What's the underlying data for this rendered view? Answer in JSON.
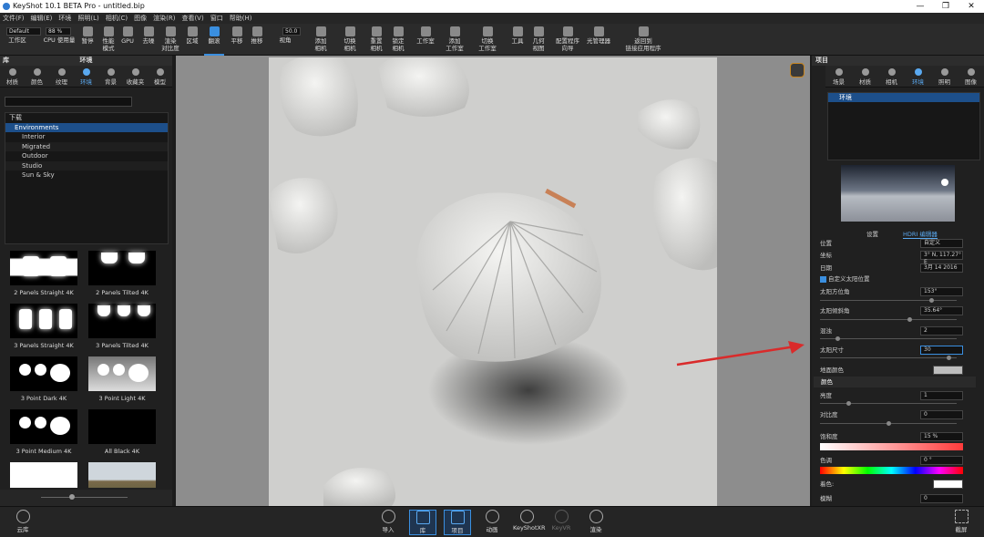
{
  "app": {
    "title": "KeyShot 10.1 BETA Pro - untitled.bip",
    "win": [
      "—",
      "❐",
      "✕"
    ]
  },
  "menu": [
    "文件(F)",
    "编辑(E)",
    "环境",
    "照明(L)",
    "相机(C)",
    "图像",
    "渲染(R)",
    "查看(V)",
    "窗口",
    "帮助(H)"
  ],
  "toolbar": {
    "workspace_value": "Default",
    "zoom_value": "88 %",
    "fov_value": "50.0",
    "items": [
      {
        "label": "工作区"
      },
      {
        "label": "CPU 使用量"
      },
      {
        "label": "暂停"
      },
      {
        "label": "性能\n模式"
      },
      {
        "label": "GPU"
      },
      {
        "label": "去噪"
      },
      {
        "label": "渲染\n对比度"
      },
      {
        "label": "区域"
      },
      {
        "label": "翻滚",
        "active": true
      },
      {
        "label": "平移"
      },
      {
        "label": "推移"
      },
      {
        "label": "视角"
      },
      {
        "label": "添加\n相机"
      },
      {
        "label": "切换\n相机"
      },
      {
        "label": "重置\n相机"
      },
      {
        "label": "锁定\n相机"
      },
      {
        "label": "工作室"
      },
      {
        "label": "添加\n工作室"
      },
      {
        "label": "切换\n工作室"
      },
      {
        "label": "工具"
      },
      {
        "label": "几何\n视图"
      },
      {
        "label": "配置程序\n向导"
      },
      {
        "label": "光管理器"
      },
      {
        "label": "返回到\n链接应用程序"
      }
    ]
  },
  "library": {
    "title": "库",
    "subtitle": "环境",
    "tabs": [
      {
        "label": "材质"
      },
      {
        "label": "颜色"
      },
      {
        "label": "纹理"
      },
      {
        "label": "环境",
        "selected": true
      },
      {
        "label": "背景"
      },
      {
        "label": "收藏夹"
      },
      {
        "label": "模型"
      }
    ],
    "tree": [
      {
        "label": "下载"
      },
      {
        "label": "Environments",
        "selected": true
      },
      {
        "label": "Interior"
      },
      {
        "label": "Migrated"
      },
      {
        "label": "Outdoor"
      },
      {
        "label": "Studio"
      },
      {
        "label": "Sun & Sky"
      }
    ],
    "thumbs": [
      "2 Panels Straight 4K",
      "2 Panels Tilted 4K",
      "3 Panels Straight 4K",
      "3 Panels Tilted 4K",
      "3 Point Dark 4K",
      "3 Point Light 4K",
      "3 Point Medium 4K",
      "All Black 4K",
      "",
      ""
    ]
  },
  "project": {
    "title": "项目",
    "tabs": [
      {
        "label": "场景"
      },
      {
        "label": "材质"
      },
      {
        "label": "相机"
      },
      {
        "label": "环境",
        "selected": true
      },
      {
        "label": "照明"
      },
      {
        "label": "图像"
      }
    ],
    "env_item": "环境",
    "subtabs": [
      "设置",
      "HDRI 编辑器"
    ],
    "props": {
      "position": "位置",
      "position_value": "自定义",
      "coords_label": "坐标",
      "coords_value": "3° N, 117.27° E",
      "date_label": "日期",
      "date_value": "3月 14 2016",
      "custom_sun": "自定义太阳位置",
      "azimuth_label": "太阳方位角",
      "azimuth_value": "153°",
      "elevation_label": "太阳倾斜角",
      "elevation_value": "35.64°",
      "turbidity_label": "混浊",
      "turbidity_value": "2",
      "sunsize_label": "太阳尺寸",
      "sunsize_value": "30",
      "ground_label": "地面颜色",
      "color_section": "颜色",
      "brightness_label": "亮度",
      "brightness_value": "1",
      "contrast_label": "对比度",
      "contrast_value": "0",
      "saturation_label": "饱和度",
      "saturation_value": "15 %",
      "hue_label": "色调",
      "hue_value": "0 °",
      "tint_label": "着色:",
      "blur_label": "模糊",
      "blur_value": "0"
    },
    "levels": {
      "azimuth": 0.83,
      "elevation": 0.66,
      "turbidity": 0.12,
      "sunsize": 0.96,
      "brightness": 0.2,
      "contrast": 0.5
    }
  },
  "bottom": {
    "cloud": "云库",
    "items": [
      "导入",
      "库",
      "项目",
      "动画",
      "KeyShotXR",
      "KeyVR",
      "渲染"
    ],
    "screenshot": "截屏"
  },
  "colors": {
    "accent": "#3a8fe0",
    "arrow": "#d92b2b"
  }
}
